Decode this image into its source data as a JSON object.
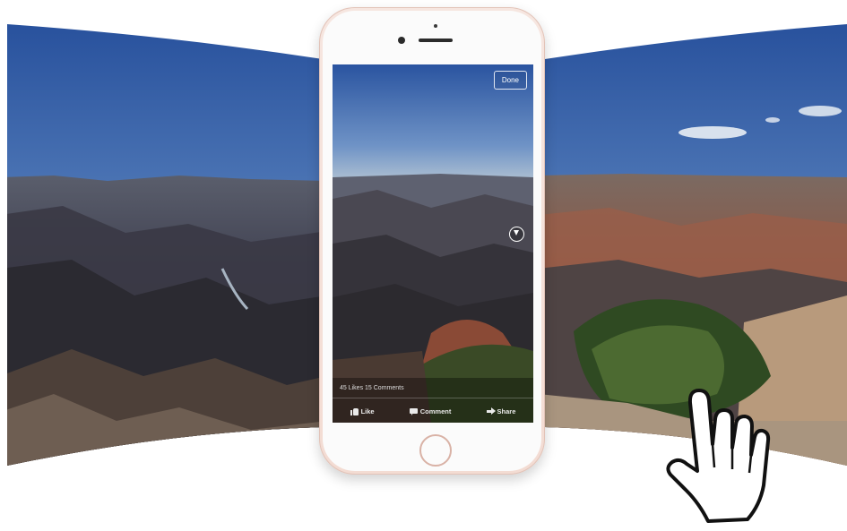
{
  "viewer": {
    "done_label": "Done"
  },
  "post": {
    "counts_text": "45 Likes 15 Comments",
    "actions": [
      {
        "label": "Like",
        "icon": "like-icon"
      },
      {
        "label": "Comment",
        "icon": "comment-icon"
      },
      {
        "label": "Share",
        "icon": "share-icon"
      }
    ]
  },
  "overlay": {
    "compass_icon": "compass-icon",
    "gesture_icon": "hand-pointer-icon"
  },
  "colors": {
    "phone_body": "#f4dfd6",
    "sky_top": "#27509c",
    "sky_horizon": "#9db4cc"
  }
}
